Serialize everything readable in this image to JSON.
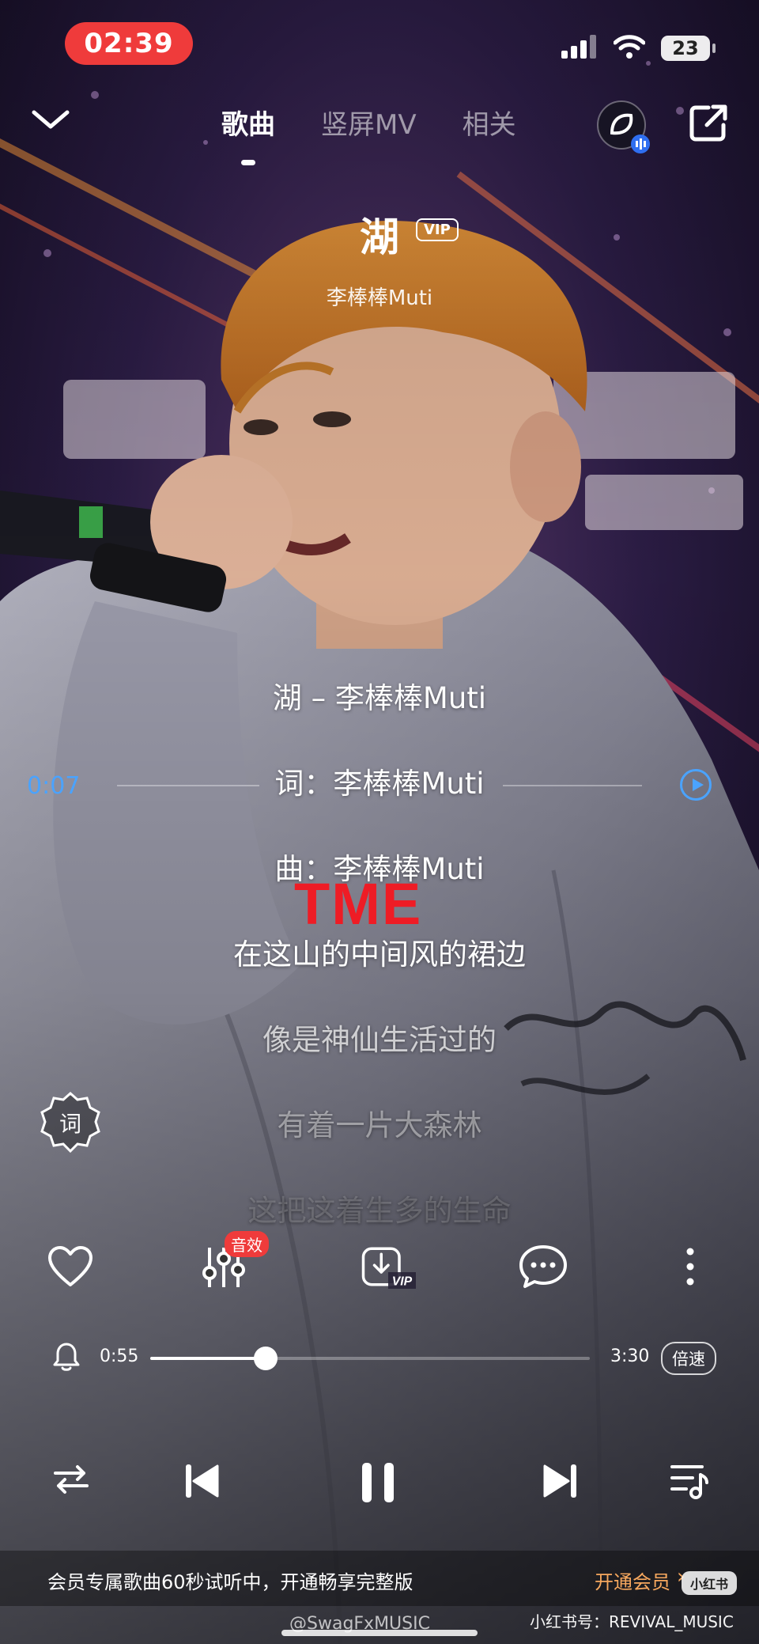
{
  "status_bar": {
    "time": "02:39",
    "battery": "23"
  },
  "nav": {
    "tabs": [
      {
        "label": "歌曲",
        "active": true
      },
      {
        "label": "竖屏MV",
        "active": false
      },
      {
        "label": "相关",
        "active": false
      }
    ],
    "icons": [
      "chevron-down-icon",
      "listen-together-icon",
      "share-icon"
    ]
  },
  "song": {
    "title": "湖",
    "badge": "VIP",
    "artist": "李棒棒Muti"
  },
  "lyrics": [
    "湖 – 李棒棒Muti",
    "词：李棒棒Muti",
    "曲：李棒棒Muti",
    "在这山的中间风的裙边",
    "像是神仙生活过的",
    "有着一片大森林",
    "这把这着生多的生命"
  ],
  "lyric_seek": {
    "time": "0:07"
  },
  "overlay": {
    "tme": "TME"
  },
  "lyric_button": {
    "label": "词"
  },
  "actions": {
    "effect_badge": "音效",
    "download_tag": "VIP",
    "icons": [
      "heart-icon",
      "equalizer-icon",
      "download-vip-icon",
      "comment-icon",
      "more-icon"
    ]
  },
  "progress": {
    "current": "0:55",
    "total": "3:30",
    "fraction": 0.262,
    "speed_label": "倍速"
  },
  "controls": [
    "shuffle-icon",
    "previous-icon",
    "pause-icon",
    "next-icon",
    "playlist-icon"
  ],
  "banner": {
    "text": "会员专属歌曲60秒试听中，开通畅享完整版",
    "link": "开通会员",
    "chevron": "›"
  },
  "watermarks": {
    "left": "@SwagFxMUSIC",
    "right": "小红书号：REVIVAL_MUSIC",
    "badge": "小红书"
  },
  "colors": {
    "accent_red": "#ef3b3b",
    "seek_blue": "#4aa3ff",
    "vip_orange": "#f7a85e"
  }
}
